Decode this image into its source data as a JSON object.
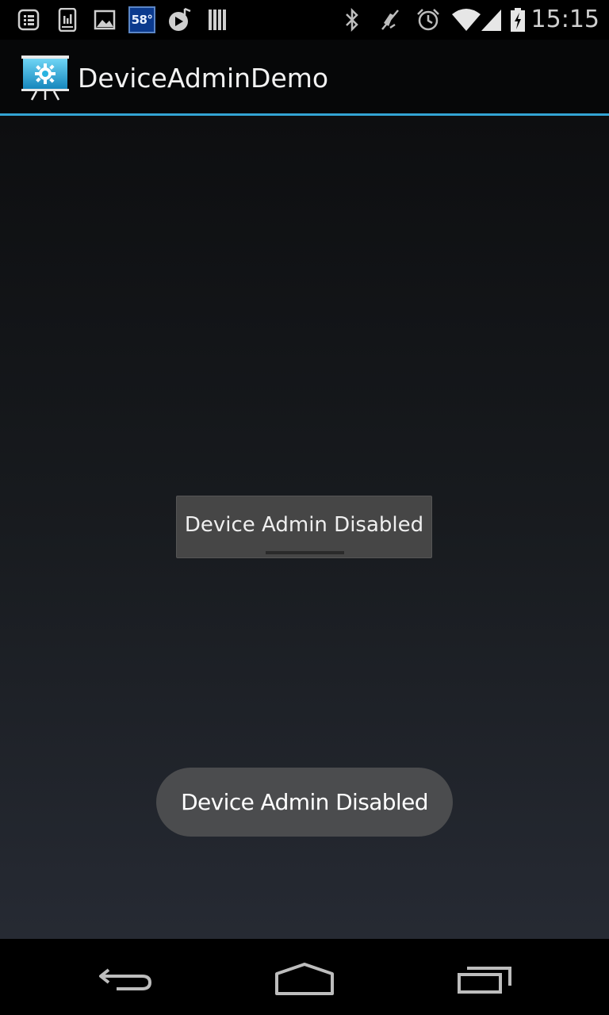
{
  "status_bar": {
    "icons": [
      "notification-list-icon",
      "sim-card-icon",
      "image-icon",
      "weather-temperature-badge",
      "music-play-icon",
      "barcode-icon",
      "bluetooth-icon",
      "mute-icon",
      "alarm-icon",
      "wifi-icon",
      "signal-icon",
      "battery-charging-icon"
    ],
    "temperature": "58°",
    "time": "15:15"
  },
  "action_bar": {
    "title": "DeviceAdminDemo",
    "icon": "presentation-gear-icon",
    "accent_color": "#33a4d4"
  },
  "main": {
    "button_label": "Device Admin Disabled"
  },
  "toast": {
    "message": "Device Admin Disabled"
  },
  "nav_bar": {
    "buttons": [
      "back-icon",
      "home-icon",
      "recent-apps-icon"
    ]
  }
}
